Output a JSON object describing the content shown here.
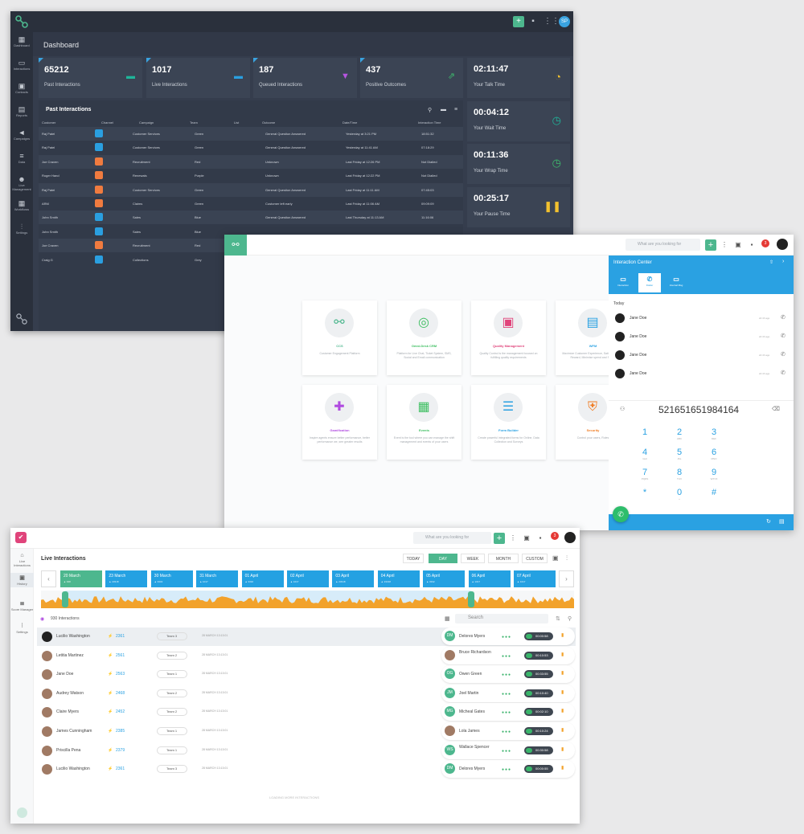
{
  "dashboard": {
    "title": "Dashboard",
    "avatar": "SP",
    "sidebar": [
      "Dashboard",
      "Interactions",
      "Contacts",
      "Reports",
      "Campaigns",
      "Data",
      "Live Management",
      "Workflows",
      "Settings"
    ],
    "kpis": [
      {
        "value": "65212",
        "label": "Past Interactions",
        "icon": "chat-icon",
        "color": "#1fb59a"
      },
      {
        "value": "1017",
        "label": "Live Interactions",
        "icon": "chat-icon",
        "color": "#2a9fe0"
      },
      {
        "value": "187",
        "label": "Queued Interactions",
        "icon": "funnel-icon",
        "color": "#b655e0"
      },
      {
        "value": "437",
        "label": "Positive Outcomes",
        "icon": "trend-icon",
        "color": "#3dbb6c"
      }
    ],
    "timers": [
      {
        "value": "02:11:47",
        "label": "Your Talk Time",
        "icon": "stopwatch-icon",
        "color": "#f2c12e"
      },
      {
        "value": "00:04:12",
        "label": "Your Wait Time",
        "icon": "clock-icon",
        "color": "#1fb59a"
      },
      {
        "value": "00:11:36",
        "label": "Your Wrap Time",
        "icon": "clock-icon",
        "color": "#3dbb6c"
      },
      {
        "value": "00:25:17",
        "label": "Your Pause Time",
        "icon": "pause-icon",
        "color": "#f2c12e"
      }
    ],
    "table": {
      "title": "Past Interactions",
      "headers": [
        "Customer",
        "Channel",
        "Campaign",
        "Team",
        "List",
        "Outcome",
        "Date/Time",
        "Interaction Time"
      ],
      "rows": [
        {
          "customer": "Raj Patel",
          "channel": "chat",
          "campaign": "Customer Services",
          "team": "Green",
          "outcome": "General Question Answered",
          "date": "Yesterday at 3:21 PM",
          "time": "18:51:32"
        },
        {
          "customer": "Raj Patel",
          "channel": "chat",
          "campaign": "Customer Services",
          "team": "Green",
          "outcome": "General Question Answered",
          "date": "Yesterday at 11:41 AM",
          "time": "07:18:29"
        },
        {
          "customer": "Joe Craven",
          "channel": "mail",
          "campaign": "Recruitment",
          "team": "Red",
          "outcome": "Unknown",
          "date": "Last Friday at 12:26 PM",
          "time": "Not Dialled"
        },
        {
          "customer": "Roger Hand",
          "channel": "mail",
          "campaign": "Renewals",
          "team": "Purple",
          "outcome": "Unknown",
          "date": "Last Friday at 12:22 PM",
          "time": "Not Dialled"
        },
        {
          "customer": "Raj Patel",
          "channel": "mail",
          "campaign": "Customer Services",
          "team": "Green",
          "outcome": "General Question Answered",
          "date": "Last Friday at 11:11 AM",
          "time": "07:45:03"
        },
        {
          "customer": "ARM",
          "channel": "mail",
          "campaign": "Claims",
          "team": "Green",
          "outcome": "Customer left early",
          "date": "Last Friday at 11:06 AM",
          "time": "09:09:09"
        },
        {
          "customer": "John Smith",
          "channel": "chat",
          "campaign": "Sales",
          "team": "Blue",
          "outcome": "General Question Answered",
          "date": "Last Thursday at 11:13 AM",
          "time": "11:16:06"
        },
        {
          "customer": "John Smith",
          "channel": "chat",
          "campaign": "Sales",
          "team": "Blue",
          "outcome": "",
          "date": "",
          "time": ""
        },
        {
          "customer": "Joe Craven",
          "channel": "mail",
          "campaign": "Recruitment",
          "team": "Red",
          "outcome": "",
          "date": "",
          "time": ""
        },
        {
          "customer": "Craig G",
          "channel": "chat",
          "campaign": "Collections",
          "team": "Grey",
          "outcome": "",
          "date": "",
          "time": ""
        }
      ]
    }
  },
  "center": {
    "search_placeholder": "What are you looking for",
    "notif_count": "3",
    "cards": [
      {
        "name": "CCS",
        "desc": "Customer Engagement Platform",
        "icon": "network-icon",
        "color": "#4db78e"
      },
      {
        "name": "Omni-Desk CRM",
        "desc": "Platform for Live Chat, Ticket System, SMS, Social and Email communication",
        "icon": "ring-icon",
        "color": "#3fbf62"
      },
      {
        "name": "Quality Management",
        "desc": "Quality Control is the management focused on fulfilling quality requirements",
        "icon": "briefcase-icon",
        "color": "#e0447b"
      },
      {
        "name": "WFM",
        "desc": "Maximize Customer Experience, Satisfaction and Reward, Minimise spend and Stress",
        "icon": "badge-icon",
        "color": "#2aa1e2"
      },
      {
        "name": "Gamification",
        "desc": "Inspire agents ensure better performance, better performance we, see greater results",
        "icon": "gamepad-icon",
        "color": "#b04be0"
      },
      {
        "name": "Events",
        "desc": "Event is the tool where you can manage the shift management and events of your users",
        "icon": "calendar-icon",
        "color": "#3fbf62"
      },
      {
        "name": "Form Builder",
        "desc": "Create powerful integrated forms for Online, Data Collection and Surveys",
        "icon": "form-icon",
        "color": "#2aa1e2"
      },
      {
        "name": "Security",
        "desc": "Control your users, Roles",
        "icon": "shield-icon",
        "color": "#f07b21"
      }
    ],
    "interaction_center": {
      "title": "Interaction Center",
      "tabs": [
        "Interaction",
        "Dialler",
        "Internal Msg"
      ],
      "section": "Today",
      "contacts": [
        {
          "name": "Jane Doe",
          "ago": "2d 4h ago"
        },
        {
          "name": "Jane Doe",
          "ago": "2d 4h ago"
        },
        {
          "name": "Jane Doe",
          "ago": "2d 4h ago"
        },
        {
          "name": "Jane Doe",
          "ago": "2d 4h ago"
        }
      ],
      "number": "521651651984164",
      "keys": [
        {
          "d": "1",
          "s": ""
        },
        {
          "d": "2",
          "s": "ABC"
        },
        {
          "d": "3",
          "s": "DEF"
        },
        {
          "d": "4",
          "s": "GHI"
        },
        {
          "d": "5",
          "s": "JKL"
        },
        {
          "d": "6",
          "s": "MNO"
        },
        {
          "d": "7",
          "s": "PQRS"
        },
        {
          "d": "8",
          "s": "TUV"
        },
        {
          "d": "9",
          "s": "WXYZ"
        },
        {
          "d": "*",
          "s": ""
        },
        {
          "d": "0",
          "s": "+"
        },
        {
          "d": "#",
          "s": ""
        }
      ]
    }
  },
  "live": {
    "title": "Live Interactions",
    "search_placeholder": "What are you looking for",
    "notif_count": "3",
    "sidebar": [
      "Live Interactions",
      "History",
      "Score Manager",
      "Settings"
    ],
    "periods": [
      "TODAY",
      "DAY",
      "WEEK",
      "MONTH",
      "CUSTOM"
    ],
    "active_period": "DAY",
    "dates": [
      {
        "label": "20 March",
        "sub": "▲ 938"
      },
      {
        "label": "23 March",
        "sub": "▲ 23318"
      },
      {
        "label": "30 March",
        "sub": "▲ 3332"
      },
      {
        "label": "31 March",
        "sub": "▲ 1017"
      },
      {
        "label": "01 April",
        "sub": "▲ 3332"
      },
      {
        "label": "02 April",
        "sub": "▲ 1017"
      },
      {
        "label": "03 April",
        "sub": "▲ 23318"
      },
      {
        "label": "04 April",
        "sub": "▲ 23318"
      },
      {
        "label": "05 April",
        "sub": "▲ 3332"
      },
      {
        "label": "06 April",
        "sub": "▲ 1017"
      },
      {
        "label": "07 April",
        "sub": "▲ 1017"
      }
    ],
    "count_label": "930 Interactions",
    "search_label": "Search",
    "rows": [
      {
        "name": "Lucilio Washington",
        "id": "2361",
        "team": "Team 3",
        "date": "28 MARCH 13:13:01",
        "agent": "Delores Myers",
        "agent_init": "DM",
        "timer": "00:00:58"
      },
      {
        "name": "Letitia Martinez",
        "id": "2561",
        "team": "Team 2",
        "date": "28 MARCH 13:13:01",
        "agent": "Bruce Richardson",
        "agent_init": "",
        "timer": "00:10:53"
      },
      {
        "name": "Jane Doe",
        "id": "2563",
        "team": "Team 1",
        "date": "28 MARCH 13:13:01",
        "agent": "Owen Green",
        "agent_init": "OG",
        "timer": "00:33:55"
      },
      {
        "name": "Audrey Watson",
        "id": "2468",
        "team": "Team 2",
        "date": "28 MARCH 13:13:01",
        "agent": "Joel Martin",
        "agent_init": "JM",
        "timer": "00:10:40"
      },
      {
        "name": "Claire Myers",
        "id": "2452",
        "team": "Team 2",
        "date": "28 MARCH 13:13:01",
        "agent": "Micheal Gates",
        "agent_init": "MG",
        "timer": "00:02:10"
      },
      {
        "name": "James Cunningham",
        "id": "2385",
        "team": "Team 1",
        "date": "28 MARCH 13:13:01",
        "agent": "Lola James",
        "agent_init": "",
        "timer": "00:10:24"
      },
      {
        "name": "Priscilla Pena",
        "id": "2379",
        "team": "Team 1",
        "date": "28 MARCH 13:13:01",
        "agent": "Wallace Spencer",
        "agent_init": "WS",
        "timer": "00:30:58"
      },
      {
        "name": "Lucilio Washington",
        "id": "2361",
        "team": "Team 3",
        "date": "28 MARCH 13:13:01",
        "agent": "Delores Myers",
        "agent_init": "DM",
        "timer": "00:00:55"
      }
    ],
    "footer": "LOADING MORE INTERACTIONS"
  }
}
